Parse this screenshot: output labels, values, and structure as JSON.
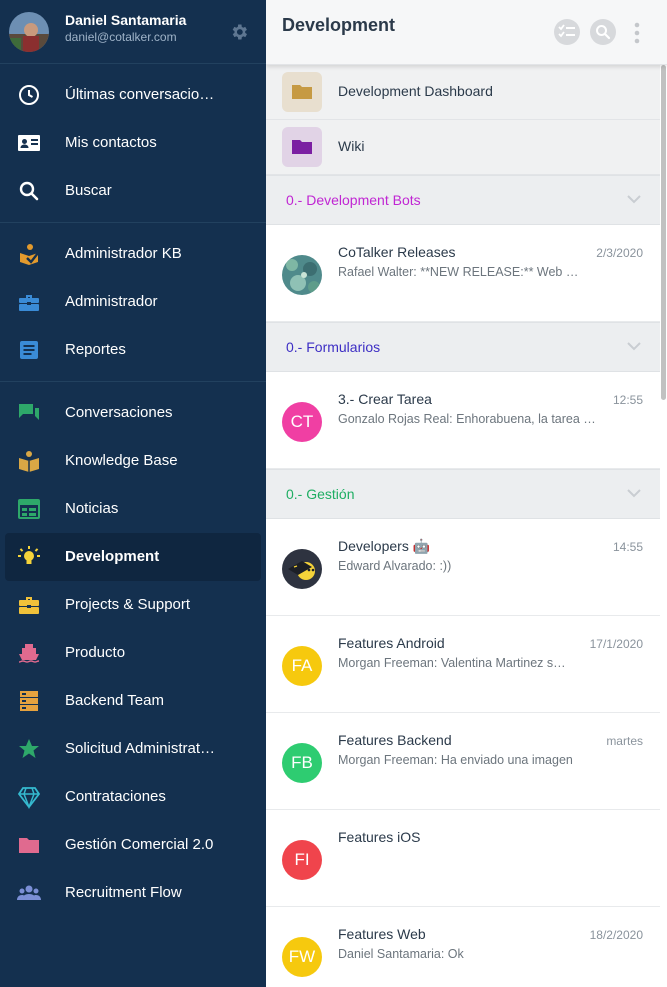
{
  "profile": {
    "name": "Daniel Santamaria",
    "email": "daniel@cotalker.com"
  },
  "sidebar": {
    "group1": [
      {
        "label": "Últimas conversacio…",
        "icon": "clock-icon"
      },
      {
        "label": "Mis contactos",
        "icon": "contact-card-icon"
      },
      {
        "label": "Buscar",
        "icon": "search-icon"
      }
    ],
    "group2": [
      {
        "label": "Administrador KB",
        "icon": "admin-kb-icon"
      },
      {
        "label": "Administrador",
        "icon": "toolbox-icon"
      },
      {
        "label": "Reportes",
        "icon": "document-icon"
      }
    ],
    "group3": [
      {
        "label": "Conversaciones",
        "icon": "chat-icon"
      },
      {
        "label": "Knowledge Base",
        "icon": "book-icon"
      },
      {
        "label": "Noticias",
        "icon": "calendar-icon"
      },
      {
        "label": "Development",
        "icon": "lightbulb-icon",
        "active": true
      },
      {
        "label": "Projects & Support",
        "icon": "toolbox-icon"
      },
      {
        "label": "Producto",
        "icon": "ship-icon"
      },
      {
        "label": "Backend Team",
        "icon": "server-icon"
      },
      {
        "label": "Solicitud Administrat…",
        "icon": "star-icon"
      },
      {
        "label": "Contrataciones",
        "icon": "diamond-icon"
      },
      {
        "label": "Gestión Comercial 2.0",
        "icon": "folder-icon"
      },
      {
        "label": "Recruitment Flow",
        "icon": "people-icon"
      }
    ]
  },
  "header": {
    "title": "Development"
  },
  "folders": [
    {
      "label": "Development Dashboard",
      "color": "#c69a43",
      "bg": "#e8dfcf"
    },
    {
      "label": "Wiki",
      "color": "#7b1fa2",
      "bg": "#e1d3e6"
    }
  ],
  "sections": [
    {
      "title": "0.- Development Bots",
      "color": "#c026d3",
      "conversations": [
        {
          "name": "CoTalker Releases",
          "time": "2/3/2020",
          "preview": "Rafael Walter: **NEW RELEASE:** Web …",
          "avatar_type": "image"
        }
      ]
    },
    {
      "title": "0.- Formularios",
      "color": "#3d2ec4",
      "conversations": [
        {
          "name": "3.- Crear Tarea",
          "time": "12:55",
          "preview": "Gonzalo Rojas Real: Enhorabuena, la tarea …",
          "avatar_type": "initials",
          "initials": "CT",
          "color": "#f03fa3"
        }
      ]
    },
    {
      "title": "0.- Gestión",
      "color": "#1fae63",
      "conversations": [
        {
          "name": "Developers 🤖",
          "time": "14:55",
          "preview": "Edward Alvarado: :))",
          "avatar_type": "image2"
        },
        {
          "name": "Features Android",
          "time": "17/1/2020",
          "preview": "Morgan Freeman: Valentina Martinez s…",
          "avatar_type": "initials",
          "initials": "FA",
          "color": "#f6c90e"
        },
        {
          "name": "Features Backend",
          "time": "martes",
          "preview": "Morgan Freeman: Ha enviado una imagen",
          "avatar_type": "initials",
          "initials": "FB",
          "color": "#2ecc71"
        },
        {
          "name": "Features iOS",
          "time": "",
          "preview": "",
          "avatar_type": "initials",
          "initials": "FI",
          "color": "#f0444c"
        },
        {
          "name": "Features Web",
          "time": "18/2/2020",
          "preview": "Daniel Santamaria: Ok",
          "avatar_type": "initials",
          "initials": "FW",
          "color": "#f6c90e"
        }
      ]
    }
  ]
}
